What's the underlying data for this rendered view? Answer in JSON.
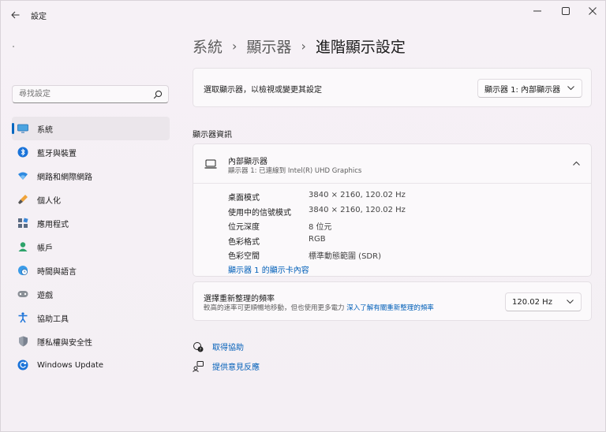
{
  "window": {
    "app_title": "設定"
  },
  "sidebar": {
    "search": {
      "value": "",
      "placeholder": "尋找設定"
    },
    "items": [
      {
        "label": "系統",
        "icon": "display-icon",
        "active": true
      },
      {
        "label": "藍牙與裝置",
        "icon": "bluetooth-icon"
      },
      {
        "label": "網路和網際網路",
        "icon": "wifi-icon"
      },
      {
        "label": "個人化",
        "icon": "brush-icon"
      },
      {
        "label": "應用程式",
        "icon": "apps-icon"
      },
      {
        "label": "帳戶",
        "icon": "person-icon"
      },
      {
        "label": "時間與語言",
        "icon": "globe-clock-icon"
      },
      {
        "label": "遊戲",
        "icon": "gamepad-icon"
      },
      {
        "label": "協助工具",
        "icon": "accessibility-icon"
      },
      {
        "label": "隱私權與安全性",
        "icon": "shield-icon"
      },
      {
        "label": "Windows Update",
        "icon": "update-icon"
      }
    ]
  },
  "breadcrumb": {
    "items": [
      "系統",
      "顯示器",
      "進階顯示設定"
    ],
    "separator": "›"
  },
  "select_display": {
    "label": "選取顯示器，以檢視或變更其設定",
    "value": "顯示器 1: 內部顯示器"
  },
  "display_info": {
    "section_title": "顯示器資訊",
    "name": "內部顯示器",
    "subtitle": "顯示器 1: 已連線到 Intel(R) UHD Graphics",
    "rows": [
      {
        "key": "桌面模式",
        "value": "3840 × 2160, 120.02 Hz"
      },
      {
        "key": "使用中的信號模式",
        "value": "3840 × 2160, 120.02 Hz"
      },
      {
        "key": "位元深度",
        "value": "8 位元"
      },
      {
        "key": "色彩格式",
        "value": "RGB"
      },
      {
        "key": "色彩空間",
        "value": "標準動態範圍 (SDR)"
      }
    ],
    "adapter_link": "顯示器 1 的顯示卡內容"
  },
  "refresh_rate": {
    "title": "選擇重新整理的頻率",
    "description": "較高的速率可更順暢地移動，但也使用更多電力",
    "link": "深入了解有關重新整理的頻率",
    "value": "120.02 Hz"
  },
  "help": {
    "get_help": "取得協助",
    "feedback": "提供意見反應"
  },
  "colors": {
    "accent": "#0067c0",
    "link": "#005fb8"
  }
}
